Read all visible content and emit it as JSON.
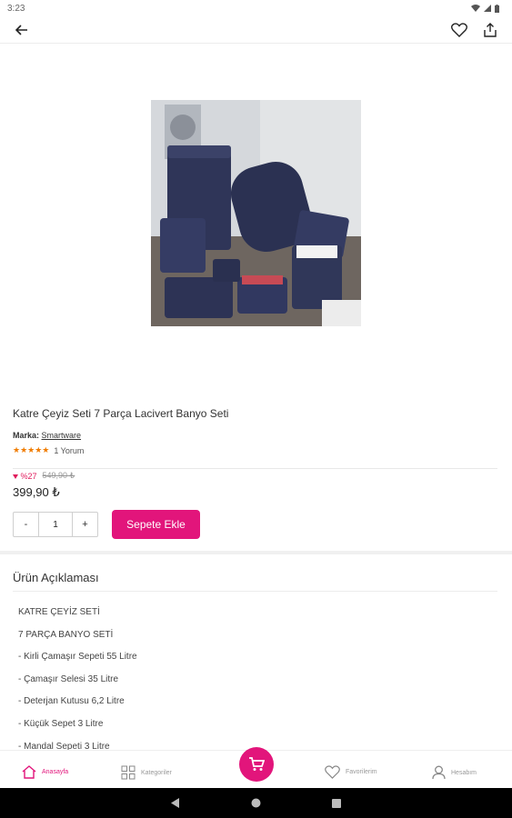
{
  "status_bar": {
    "time": "3:23"
  },
  "app_bar": {
    "back_icon": "arrow-left-icon",
    "favorite_icon": "heart-icon",
    "share_icon": "share-icon"
  },
  "product": {
    "title": "Katre Çeyiz Seti 7 Parça Lacivert Banyo Seti",
    "brand_label": "Marka:",
    "brand_name": "Smartware",
    "stars": "★★★★★",
    "review_count": "1 Yorum",
    "discount": "%27",
    "old_price": "549,90 ₺",
    "price": "399,90 ₺",
    "quantity": "1",
    "qty_minus": "-",
    "qty_plus": "+",
    "add_to_cart": "Sepete Ekle"
  },
  "description": {
    "heading": "Ürün Açıklaması",
    "lines": [
      "KATRE ÇEYİZ SETİ",
      "7 PARÇA BANYO SETİ",
      "- Kirli Çamaşır Sepeti 55 Litre",
      "- Çamaşır Selesi 35 Litre",
      "- Deterjan Kutusu 6,2 Litre",
      "- Küçük Sepet 3 Litre",
      "- Mandal Sepeti 3 Litre"
    ]
  },
  "bottom_nav": {
    "home": "Anasayfa",
    "categories": "Kategoriler",
    "favorites": "Favorilerim",
    "account": "Hesabım",
    "accent": "#e2157b"
  }
}
